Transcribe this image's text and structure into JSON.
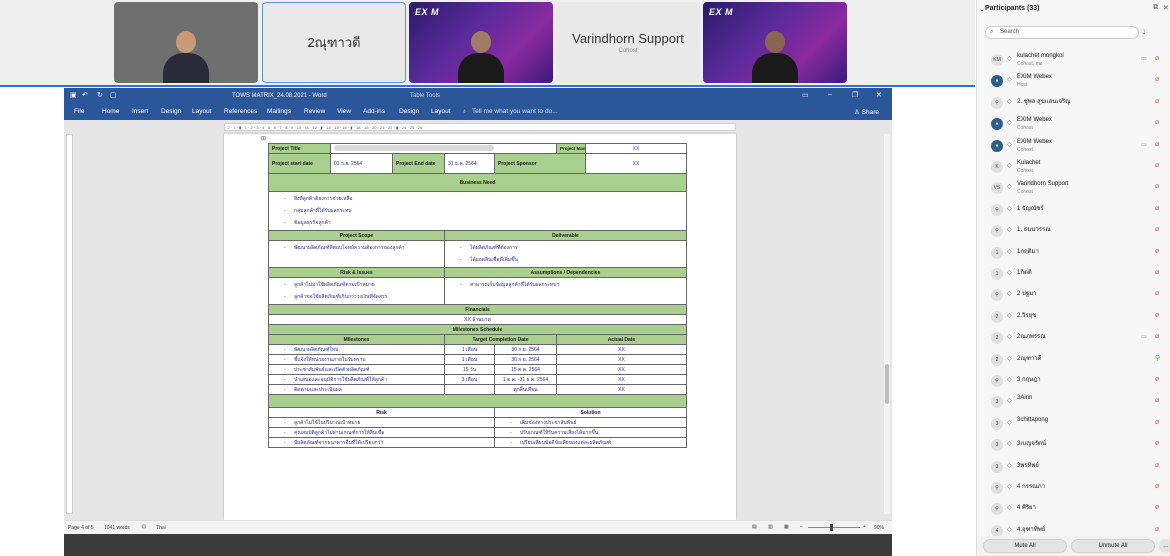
{
  "video_tiles": [
    {
      "type": "person",
      "label": ""
    },
    {
      "type": "name",
      "name": "2ณุฑาวดี"
    },
    {
      "type": "exim",
      "logo": "EX M"
    },
    {
      "type": "name",
      "name": "Varindhorn Support",
      "role": "Cohost"
    },
    {
      "type": "exim",
      "logo": "EX M"
    }
  ],
  "word": {
    "title": "TOWS MATRIX_24.08.2021 - Word",
    "table_tools": "Table Tools",
    "tabs": [
      "File",
      "Home",
      "Insert",
      "Design",
      "Layout",
      "References",
      "Mailings",
      "Review",
      "View",
      "Add-ins",
      "Design",
      "Layout"
    ],
    "tell_me": "Tell me what you want to do...",
    "share": "Share",
    "ruler_text": "· 2 · 1 · ▮ · 1 · 2 · 3 · 4 · 5 · 6 · 7 · 8 · 9 · 10 · 11 · 12 · ▮ · 14 · 15 · 16 · ▮ · 18 · 19 · 20 · 21 · 22 · ▮ · 24 · 25 · 26",
    "status": {
      "page": "Page 4 of 5",
      "words": "1041 words",
      "lang": "Thai",
      "zoom": "90%"
    }
  },
  "doc": {
    "project_title_label": "Project Title",
    "project_manager_label": "Project Manager",
    "project_manager_value": "XX",
    "start_label": "Project start date",
    "start_value": "01 ก.ย. 2564",
    "end_label": "Project End date",
    "end_value": "31 ธ.ค. 2564",
    "sponsor_label": "Project Sponsor",
    "sponsor_value": "XX",
    "business_need": "Business Need",
    "business_need_items": [
      "สิ่งที่ลูกค้าต้องการช่วยเหลือ",
      "กลุ่มลูกค้าที่ได้รับผลกระทบ",
      "ข้อมูลธุรกิจลูกค้า"
    ],
    "scope_label": "Project Scope",
    "deliverable_label": "Deliverable",
    "scope_items": [
      "พัฒนาผลิตภัณฑ์ที่ตอบโจทย์ความต้องการของลูกค้า"
    ],
    "deliverable_items": [
      "ได้ผลิตภัณฑ์ที่ต้องการ",
      "ได้ยอดสินเชื่อที่เพิ่มขึ้น"
    ],
    "risk_issue_label": "Risk & Issues",
    "assumption_label": "Assumptions / Dependencies",
    "risk_items": [
      "ลูกค้าไม่มาใช้ผลิตภัณฑ์ตามเป้าหมาย",
      "ลูกค้าขอใช้ผลิตภัณฑ์เกินกว่าวงเงินที่จัดสรร"
    ],
    "assumption_items": [
      "สามารถเก็บข้อมูลลูกค้าที่ได้รับผลกระทบฯ"
    ],
    "financials_label": "Financials",
    "financials_value": "XX ล้านบาท",
    "milestone_schedule_label": "Milestones Schedule",
    "milestone_headers": [
      "Milestones",
      "Target Completion Date",
      "Actual Date"
    ],
    "milestones": [
      {
        "name": "พัฒนาผลิตภัณฑ์ใหม่",
        "dur": "1 เดือน",
        "date": "30 ก.ย. 2564",
        "actual": "XX"
      },
      {
        "name": "ชี้แจ้งให้หน่วยงานภายในรับทราบ",
        "dur": "1 เดือน",
        "date": "30 ก.ย. 2564",
        "actual": "XX"
      },
      {
        "name": "ประชาสัมพันธ์และเปิดตัวผลิตภัณฑ์",
        "dur": "15 วัน",
        "date": "15 ต.ค. 2564",
        "actual": "XX"
      },
      {
        "name": "นำเสนอและอนุมัติการใช้ผลิตภัณฑ์ให้ลูกค้า",
        "dur": "3 เดือน",
        "date": "1 ต.ค. -31 ธ.ค. 2564",
        "actual": "XX"
      },
      {
        "name": "ติดตามและประเมินผล",
        "dur": "",
        "date": "ทุกสิ้นเดือน",
        "actual": "XX"
      }
    ],
    "risk_label": "Risk",
    "solution_label": "Solution",
    "risk_rows": [
      {
        "risk": "ลูกค้าไม่ใช้ในปริมาณเป้าหมาย",
        "solution": "เพิ่มช่องทางประชาสัมพันธ์"
      },
      {
        "risk": "คุณสมบัติลูกค้าไม่ผ่านเกณฑ์การให้สินเชื่อ",
        "solution": "ปรับเกณฑ์ให้รับความเสี่ยงได้มากขึ้น"
      },
      {
        "risk": "มีผลิตภัณฑ์จากธนาคารอื่นที่ได้เปรียบกว่า",
        "solution": "เปรียบเทียบข้อดีข้อเสียของแต่ละผลิตภัณฑ์"
      }
    ]
  },
  "participants": {
    "title": "Participants (33)",
    "search_placeholder": "Search",
    "list": [
      {
        "avatar": "KM",
        "name": "kulachet mongkol",
        "role": "Cohost, me",
        "cam": true,
        "mic_on": false
      },
      {
        "avatar": "●",
        "name": "EXIM Webex",
        "role": "Host",
        "cam": false,
        "mic_on": false,
        "blue": true
      },
      {
        "avatar": "⚲",
        "name": "2. ชูพล สุขแสนเจริญ",
        "role": "",
        "cam": false,
        "mic_on": false
      },
      {
        "avatar": "●",
        "name": "EXIM Webex",
        "role": "Cohost",
        "cam": false,
        "mic_on": false,
        "blue": true
      },
      {
        "avatar": "●",
        "name": "EXIM Webex",
        "role": "Cohost",
        "cam": true,
        "mic_on": false,
        "blue": true
      },
      {
        "avatar": "K",
        "name": "Kulachet",
        "role": "Cohost",
        "cam": false,
        "mic_on": false
      },
      {
        "avatar": "VS",
        "name": "Varindhorn Support",
        "role": "Cohost",
        "cam": false,
        "mic_on": false
      },
      {
        "avatar": "⚲",
        "name": "1 ธัญณัชร์",
        "role": "",
        "cam": false,
        "mic_on": false
      },
      {
        "avatar": "⚲",
        "name": "1. ธมนวรรณ",
        "role": "",
        "cam": false,
        "mic_on": false
      },
      {
        "avatar": "1",
        "name": "1กฤติมา",
        "role": "",
        "cam": false,
        "mic_on": false
      },
      {
        "avatar": "1",
        "name": "1กิตติ",
        "role": "",
        "cam": false,
        "mic_on": false
      },
      {
        "avatar": "⚲",
        "name": "2 ปฐมา",
        "role": "",
        "cam": false,
        "mic_on": false
      },
      {
        "avatar": "2",
        "name": "2.วิรยุช",
        "role": "",
        "cam": false,
        "mic_on": false
      },
      {
        "avatar": "2",
        "name": "2ณภพรรณ",
        "role": "",
        "cam": true,
        "mic_on": false
      },
      {
        "avatar": "2",
        "name": "2ณุฑาวดี",
        "role": "",
        "cam": false,
        "mic_on": true
      },
      {
        "avatar": "⚲",
        "name": "3 กฤษฎา",
        "role": "",
        "cam": false,
        "mic_on": false
      },
      {
        "avatar": "3",
        "name": "3Airin",
        "role": "",
        "cam": false,
        "mic_on": false
      },
      {
        "avatar": "3",
        "name": "3chittapong",
        "role": "",
        "cam": false,
        "mic_on": false
      },
      {
        "avatar": "3",
        "name": "3เบญจรัตน์",
        "role": "",
        "cam": false,
        "mic_on": false
      },
      {
        "avatar": "3",
        "name": "3พรทิพย์",
        "role": "",
        "cam": false,
        "mic_on": false
      },
      {
        "avatar": "⚲",
        "name": "4 กรรณภา",
        "role": "",
        "cam": false,
        "mic_on": false
      },
      {
        "avatar": "⚲",
        "name": "4 ศิริยา",
        "role": "",
        "cam": false,
        "mic_on": false
      },
      {
        "avatar": "4",
        "name": "4.จุฑาทิพย์",
        "role": "",
        "cam": false,
        "mic_on": false
      }
    ],
    "mute_all": "Mute All",
    "unmute_all": "Unmute All"
  },
  "colors": {
    "word_blue": "#2b579a",
    "table_green": "#a9d08e",
    "accent": "#2e74c7"
  }
}
